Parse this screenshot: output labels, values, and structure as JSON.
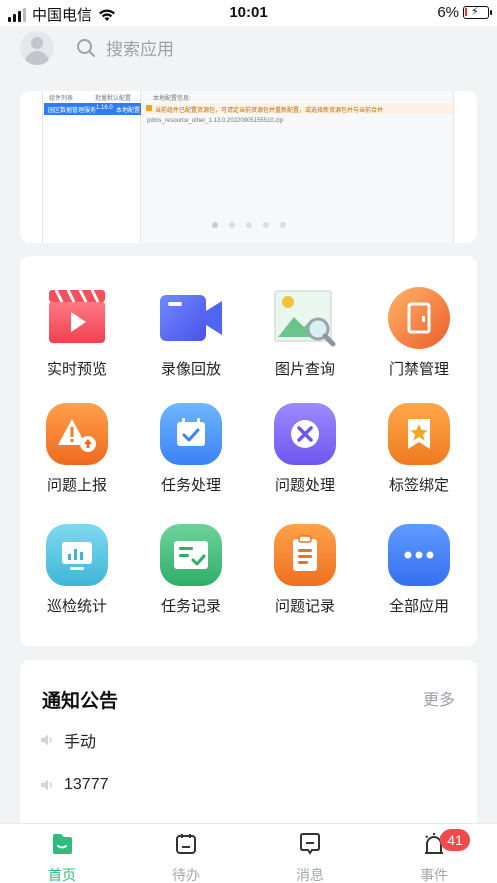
{
  "status_bar": {
    "carrier": "中国电信",
    "time": "10:01",
    "battery": "6%"
  },
  "header": {
    "search_placeholder": "搜索应用"
  },
  "banner": {
    "screenshot_text": {
      "col_a": "组件列表",
      "col_b": "批量默认配置",
      "col_c": "本地配置信息:",
      "row_name": "园区数据管理服务",
      "row_version": "1.16.0",
      "row_status": "本地配置",
      "warning": "当前组件已配置资源包，可请定当前资源包并重新配置，或选择新资源包并与当前合并",
      "file": "pdms_resource_other_1.13.0.20220905155510.zip"
    },
    "page_count": 5,
    "active_page": 1
  },
  "apps": [
    {
      "label": "实时预览",
      "icon": "video-play-icon"
    },
    {
      "label": "录像回放",
      "icon": "camera-recorder-icon"
    },
    {
      "label": "图片查询",
      "icon": "image-search-icon"
    },
    {
      "label": "门禁管理",
      "icon": "door-icon"
    },
    {
      "label": "问题上报",
      "icon": "warning-upload-icon"
    },
    {
      "label": "任务处理",
      "icon": "calendar-check-icon"
    },
    {
      "label": "问题处理",
      "icon": "tools-icon"
    },
    {
      "label": "标签绑定",
      "icon": "tag-star-icon"
    },
    {
      "label": "巡检统计",
      "icon": "bar-chart-icon"
    },
    {
      "label": "任务记录",
      "icon": "task-list-icon"
    },
    {
      "label": "问题记录",
      "icon": "clipboard-icon"
    },
    {
      "label": "全部应用",
      "icon": "more-dots-icon"
    }
  ],
  "notice": {
    "title": "通知公告",
    "more": "更多",
    "items": [
      "手动",
      "13777"
    ]
  },
  "tabs": [
    {
      "label": "首页",
      "active": true
    },
    {
      "label": "待办",
      "active": false
    },
    {
      "label": "消息",
      "active": false
    },
    {
      "label": "事件",
      "active": false,
      "badge": "41"
    }
  ],
  "colors": {
    "accent": "#2ebd7a",
    "badge": "#f04a4a",
    "background": "#f2f3f5"
  }
}
